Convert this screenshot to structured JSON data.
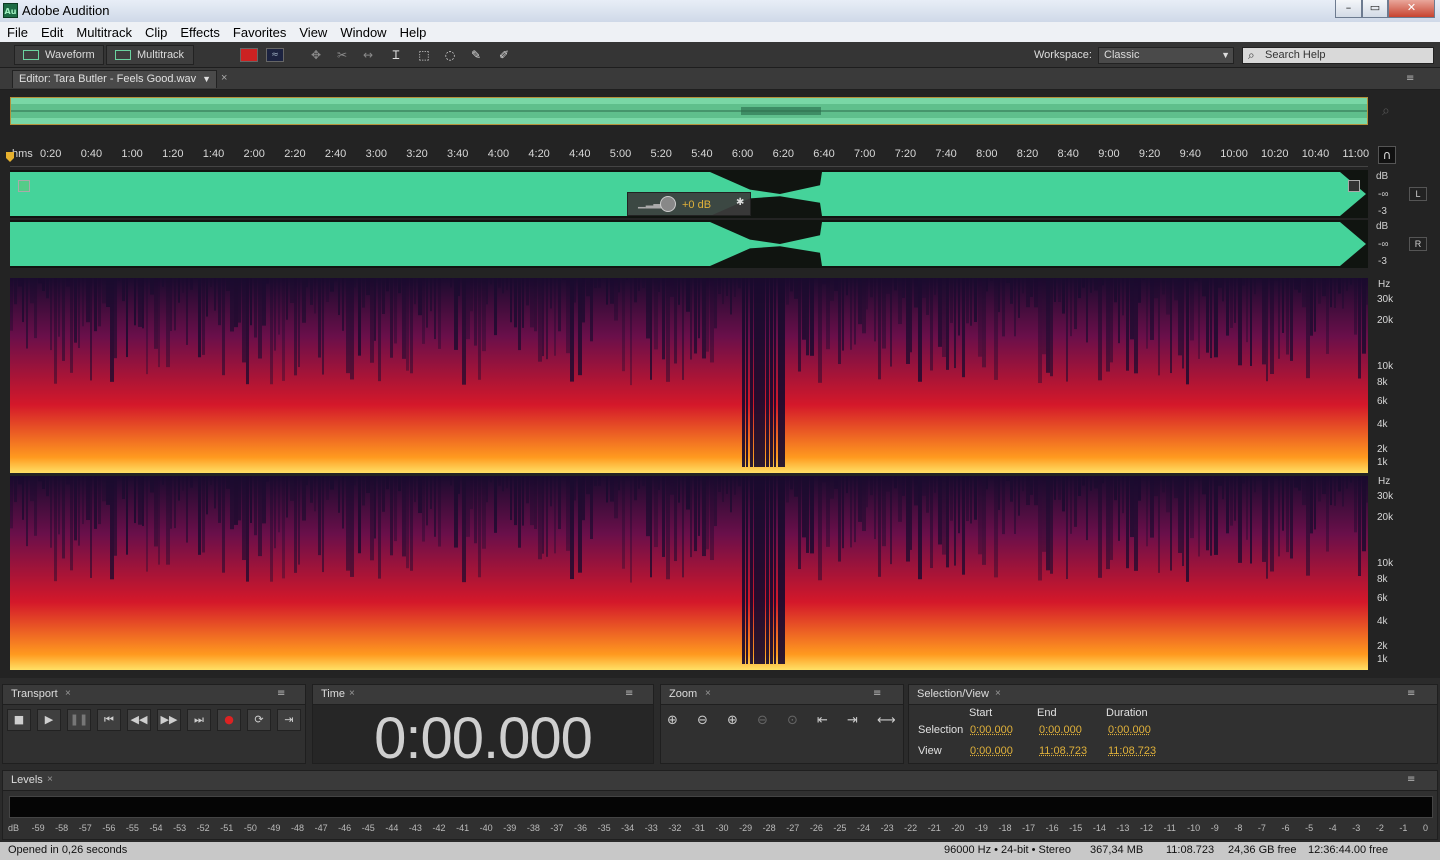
{
  "window": {
    "title": "Adobe Audition",
    "app_icon": "Au"
  },
  "menu": [
    "File",
    "Edit",
    "Multitrack",
    "Clip",
    "Effects",
    "Favorites",
    "View",
    "Window",
    "Help"
  ],
  "toolbar": {
    "waveform_label": "Waveform",
    "multitrack_label": "Multitrack",
    "workspace_label": "Workspace:",
    "workspace_value": "Classic",
    "search_placeholder": "Search Help"
  },
  "editor": {
    "tab_label": "Editor: Tara Butler - Feels Good.wav",
    "ruler_unit": "hms",
    "ruler_ticks": [
      "0:20",
      "0:40",
      "1:00",
      "1:20",
      "1:40",
      "2:00",
      "2:20",
      "2:40",
      "3:00",
      "3:20",
      "3:40",
      "4:00",
      "4:20",
      "4:40",
      "5:00",
      "5:20",
      "5:40",
      "6:00",
      "6:20",
      "6:40",
      "7:00",
      "7:20",
      "7:40",
      "8:00",
      "8:20",
      "8:40",
      "9:00",
      "9:20",
      "9:40",
      "10:00",
      "10:20",
      "10:40",
      "11:00"
    ],
    "db_labels": [
      "dB",
      "-∞",
      "-3"
    ],
    "channel_left": "L",
    "channel_right": "R",
    "hud_gain": "+0 dB",
    "hz_labels": [
      "Hz",
      "30k",
      "20k",
      "10k",
      "8k",
      "6k",
      "4k",
      "2k",
      "1k"
    ],
    "colors": {
      "waveform": "#45d39a",
      "overview": "#79d7a6",
      "spectral_low": "#1a0b2e",
      "spectral_mid": "#c8102e",
      "spectral_high": "#ffd23f"
    }
  },
  "transport": {
    "tab_label": "Transport"
  },
  "time": {
    "tab_label": "Time",
    "value": "0:00.000"
  },
  "zoom": {
    "tab_label": "Zoom"
  },
  "selection": {
    "tab_label": "Selection/View",
    "headers": [
      "Start",
      "End",
      "Duration"
    ],
    "rows": [
      {
        "label": "Selection",
        "start": "0:00.000",
        "end": "0:00.000",
        "duration": "0:00.000"
      },
      {
        "label": "View",
        "start": "0:00.000",
        "end": "11:08.723",
        "duration": "11:08.723"
      }
    ]
  },
  "levels": {
    "tab_label": "Levels",
    "scale": [
      "dB",
      "-59",
      "-58",
      "-57",
      "-56",
      "-55",
      "-54",
      "-53",
      "-52",
      "-51",
      "-50",
      "-49",
      "-48",
      "-47",
      "-46",
      "-45",
      "-44",
      "-43",
      "-42",
      "-41",
      "-40",
      "-39",
      "-38",
      "-37",
      "-36",
      "-35",
      "-34",
      "-33",
      "-32",
      "-31",
      "-30",
      "-29",
      "-28",
      "-27",
      "-26",
      "-25",
      "-24",
      "-23",
      "-22",
      "-21",
      "-20",
      "-19",
      "-18",
      "-17",
      "-16",
      "-15",
      "-14",
      "-13",
      "-12",
      "-11",
      "-10",
      "-9",
      "-8",
      "-7",
      "-6",
      "-5",
      "-4",
      "-3",
      "-2",
      "-1",
      "0"
    ]
  },
  "status": {
    "message": "Opened in 0,26 seconds",
    "format": "96000 Hz • 24-bit • Stereo",
    "size": "367,34 MB",
    "duration": "11:08.723",
    "free_space": "24,36 GB free",
    "free_time": "12:36:44.00 free"
  }
}
